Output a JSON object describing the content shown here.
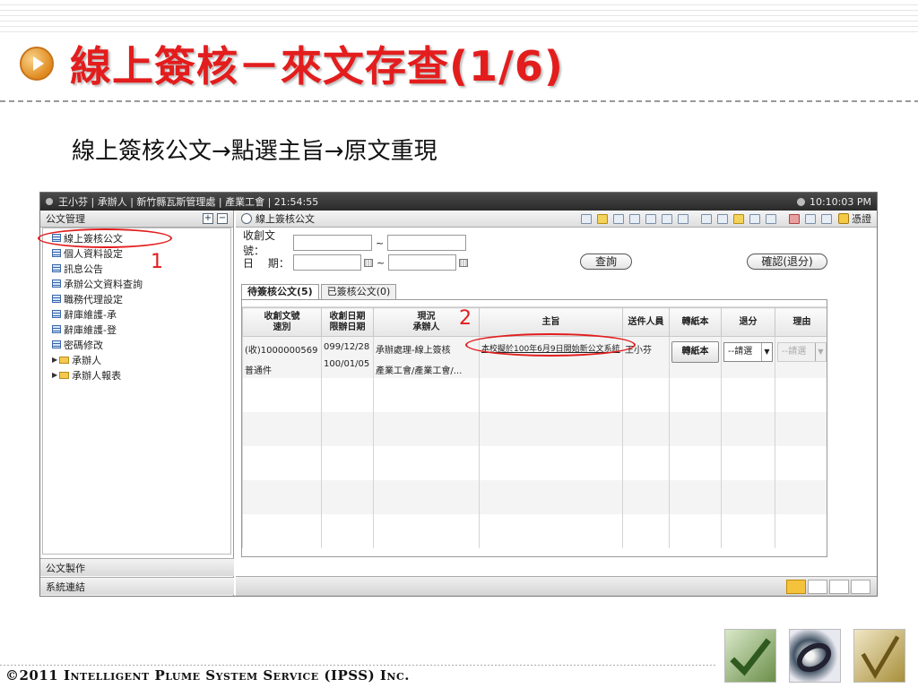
{
  "slide": {
    "title": "線上簽核－來文存查(1/6)",
    "subtitle": "線上簽核公文→點選主旨→原文重現",
    "footer": "©2011 Intelligent Plume System Service (IPSS) Inc.",
    "annotation_1": "1",
    "annotation_2": "2"
  },
  "app": {
    "titlebar_user": "王小芬 | 承辦人 | 新竹縣瓦斯管理處 | 產業工會 | 21:54:55",
    "titlebar_clock": "10:10:03 PM",
    "sidebar": {
      "header": "公文管理",
      "items": [
        {
          "label": "線上簽核公文",
          "type": "doc"
        },
        {
          "label": "個人資料設定",
          "type": "doc"
        },
        {
          "label": "訊息公告",
          "type": "doc"
        },
        {
          "label": "承辦公文資料查詢",
          "type": "doc"
        },
        {
          "label": "職務代理設定",
          "type": "doc"
        },
        {
          "label": "辭庫維護-承",
          "type": "doc"
        },
        {
          "label": "辭庫維護-登",
          "type": "doc"
        },
        {
          "label": "密碼修改",
          "type": "doc"
        },
        {
          "label": "承辦人",
          "type": "folder"
        },
        {
          "label": "承辦人報表",
          "type": "folder"
        }
      ],
      "footer_1": "公文製作",
      "footer_2": "系統連結"
    },
    "main": {
      "toolbar_title": "線上簽核公文",
      "confirm_label": "憑證",
      "form": {
        "doc_no_label": "收創文號：",
        "date_label": "日　 期：",
        "tilde": "~",
        "query_button": "查詢",
        "confirm_return_button": "確認(退分)"
      },
      "tabs": [
        {
          "label": "待簽核公文(5)",
          "active": true
        },
        {
          "label": "已簽核公文(0)",
          "active": false
        }
      ],
      "table": {
        "headers": [
          [
            "收創文號",
            "速別"
          ],
          [
            "收創日期",
            "限辦日期"
          ],
          [
            "現況",
            "承辦人"
          ],
          [
            "主旨"
          ],
          [
            "送件人員"
          ],
          [
            "轉紙本"
          ],
          [
            "退分"
          ],
          [
            "理由"
          ]
        ],
        "row": {
          "doc_no": "(收)1000000569",
          "speed": "普通件",
          "recv_date": "099/12/28",
          "due_date": "100/01/05",
          "status": "承辦處理-線上簽核",
          "handler": "產業工會/產業工會/...",
          "subject": "本校擬於100年6月9日開始新公文系統",
          "sender": "王小芬",
          "paper_button": "轉紙本",
          "return_select": "--請選",
          "reason_select": "--請選"
        }
      }
    }
  }
}
